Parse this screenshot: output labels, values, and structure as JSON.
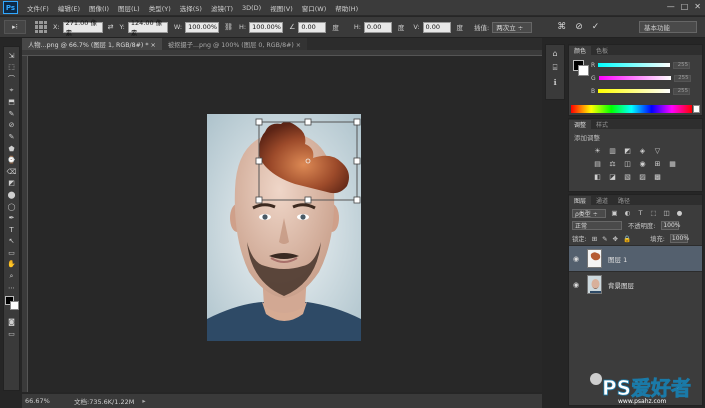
{
  "app": {
    "logo": "Ps"
  },
  "menu": [
    "文件(F)",
    "编辑(E)",
    "图像(I)",
    "图层(L)",
    "类型(Y)",
    "选择(S)",
    "滤镜(T)",
    "3D(D)",
    "视图(V)",
    "窗口(W)",
    "帮助(H)"
  ],
  "window_controls": [
    "—",
    "□",
    "✕"
  ],
  "options": {
    "tool_label": "▸⁝",
    "x_label": "X:",
    "x_value": "271.00 像素",
    "y_label": "Y:",
    "y_value": "124.00 像素",
    "w_label": "W:",
    "w_value": "100.00%",
    "h_label": "H:",
    "h_value": "100.00%",
    "angle_value": "0.00",
    "angle_unit": "度",
    "hskew_label": "H:",
    "hskew_value": "0.00",
    "hskew_unit": "度",
    "vskew_label": "V:",
    "vskew_value": "0.00",
    "vskew_unit": "度",
    "interp_label": "插值:",
    "interp_value": "两次立 ÷",
    "workspace": "基本功能"
  },
  "tabs": [
    {
      "label": "人物...png @ 66.7% (图层 1, RGB/8#) *  ×"
    },
    {
      "label": "被抠摄子...png @ 100% (图层 0, RGB/8#)  ×"
    }
  ],
  "tools": [
    "⇲",
    "⬚",
    "⌒",
    "⌖",
    "⬒",
    "✎",
    "⊘",
    "✎",
    "⬟",
    "⌚",
    "⌫",
    "◩",
    "⬤",
    "◯",
    "✒",
    "T",
    "↖",
    "▭",
    "✋",
    "⌕",
    "⋯"
  ],
  "status": {
    "zoom": "66.67%",
    "doc": "文档:735.6K/1.22M",
    "arrow": "▸"
  },
  "color_panel": {
    "tabs": [
      "颜色",
      "色板"
    ],
    "r_label": "R",
    "g_label": "G",
    "b_label": "B",
    "r_value": "255",
    "g_value": "255",
    "b_value": "255"
  },
  "adjust_panel": {
    "tabs": [
      "调整",
      "样式"
    ],
    "title": "添加调整",
    "rows": [
      [
        "☀",
        "▥",
        "◩",
        "◈",
        "▽"
      ],
      [
        "▤",
        "⚖",
        "◫",
        "◉",
        "⊞",
        "▦"
      ],
      [
        "◧",
        "◪",
        "▧",
        "▨",
        "▩"
      ]
    ]
  },
  "layers_panel": {
    "tabs": [
      "图层",
      "通道",
      "路径"
    ],
    "kind": "ρ类型 ÷",
    "filter_icons": [
      "▣",
      "◐",
      "T",
      "⬚",
      "◫",
      "●"
    ],
    "blend_mode": "正常",
    "opacity_label": "不透明度:",
    "opacity_value": "100%",
    "lock_label": "锁定:",
    "lock_icons": [
      "⊞",
      "✎",
      "✥",
      "🔒"
    ],
    "fill_label": "填充:",
    "fill_value": "100%",
    "layers": [
      {
        "name": "图层 1"
      },
      {
        "name": "背景图层"
      }
    ]
  },
  "side_icons": [
    "⌂",
    "⌸",
    "ℹ"
  ],
  "watermark": "PS爱好者",
  "watermark_sub": "www.psahz.com"
}
